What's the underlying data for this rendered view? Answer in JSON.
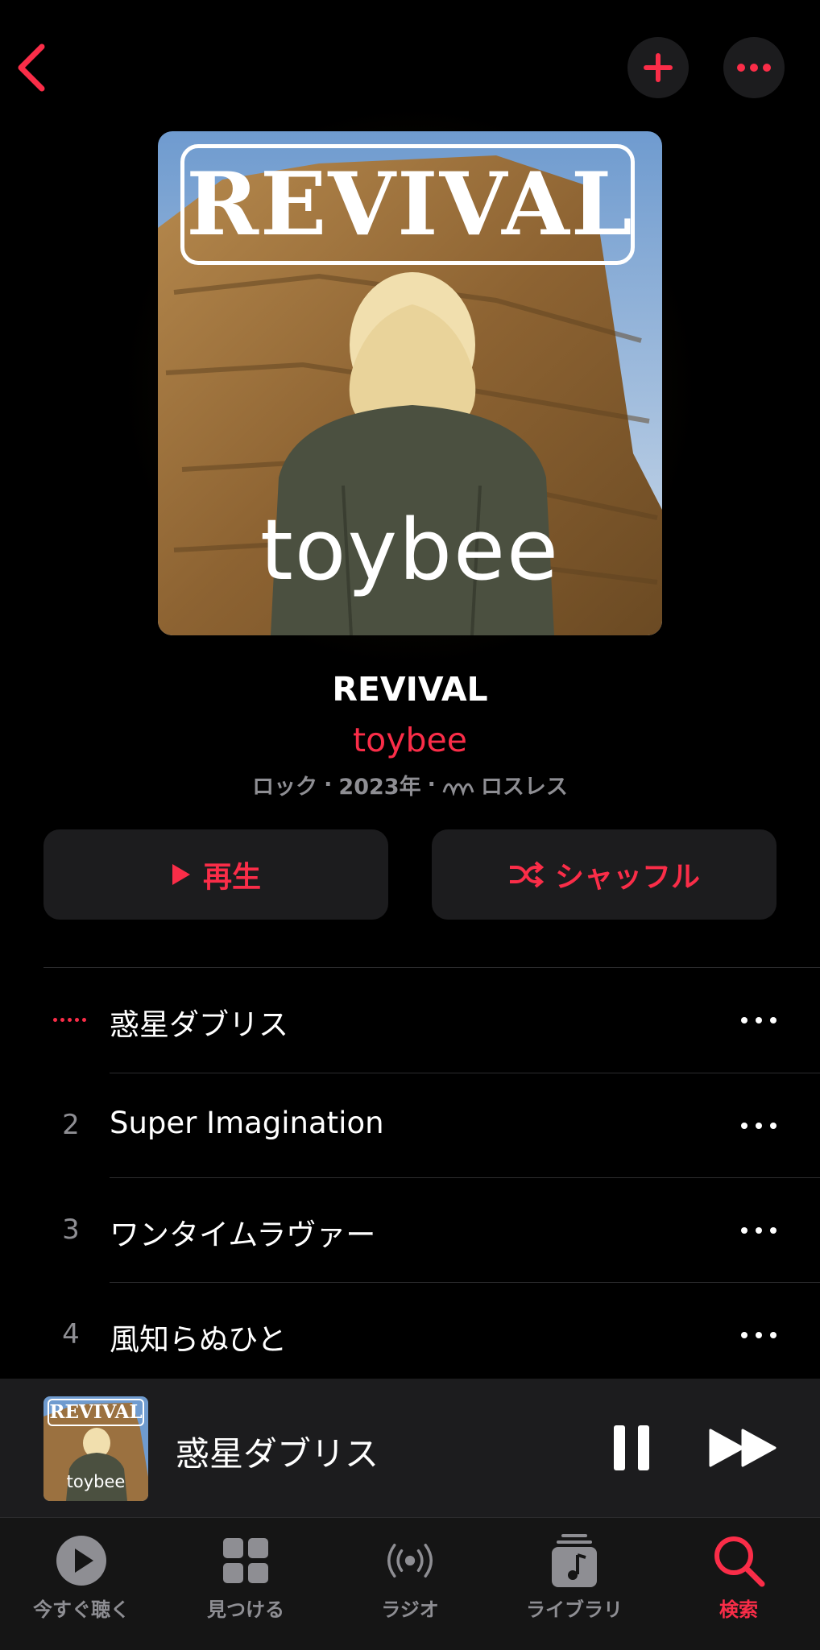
{
  "header": {
    "back_icon": "chevron-left-icon",
    "add_icon": "plus-icon",
    "more_icon": "ellipsis-icon"
  },
  "artwork": {
    "title_text": "REVIVAL",
    "artist_text": "toybee"
  },
  "album": {
    "title": "REVIVAL",
    "artist": "toybee",
    "genre": "ロック",
    "year": "2023年",
    "quality": "ロスレス",
    "separator": "·"
  },
  "actions": {
    "play_label": "再生",
    "shuffle_label": "シャッフル"
  },
  "tracks": [
    {
      "number": "",
      "title": "惑星ダブリス",
      "playing": true
    },
    {
      "number": "2",
      "title": "Super Imagination",
      "playing": false
    },
    {
      "number": "3",
      "title": "ワンタイムラヴァー",
      "playing": false
    },
    {
      "number": "4",
      "title": "風知らぬひと",
      "playing": false
    }
  ],
  "mini_player": {
    "title": "惑星ダブリス",
    "art_title": "REVIVAL",
    "art_artist": "toybee"
  },
  "tabs": [
    {
      "label": "今すぐ聴く",
      "icon": "play-circle-icon"
    },
    {
      "label": "見つける",
      "icon": "grid-icon"
    },
    {
      "label": "ラジオ",
      "icon": "radio-icon"
    },
    {
      "label": "ライブラリ",
      "icon": "music-library-icon"
    },
    {
      "label": "検索",
      "icon": "search-icon",
      "active": true
    }
  ],
  "colors": {
    "accent": "#fa2d48",
    "background": "#000000",
    "surface": "#1c1c1e",
    "secondary_text": "#8e8e93"
  }
}
